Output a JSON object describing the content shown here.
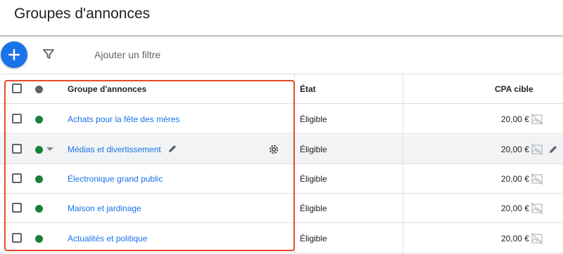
{
  "page": {
    "title": "Groupes d'annonces"
  },
  "toolbar": {
    "add_icon": "plus-icon",
    "filter_icon": "filter-icon",
    "filter_label": "Ajouter un filtre"
  },
  "table": {
    "headers": {
      "name": "Groupe d'annonces",
      "status": "État",
      "cpa": "CPA cible"
    },
    "rows": [
      {
        "name": "Achats pour la fête des mères",
        "status": "Éligible",
        "cpa": "20,00 €"
      },
      {
        "name": "Médias et divertissement",
        "status": "Éligible",
        "cpa": "20,00 €"
      },
      {
        "name": "Électronique grand public",
        "status": "Éligible",
        "cpa": "20,00 €"
      },
      {
        "name": "Maison et jardinage",
        "status": "Éligible",
        "cpa": "20,00 €"
      },
      {
        "name": "Actualités et politique",
        "status": "Éligible",
        "cpa": "20,00 €"
      }
    ]
  },
  "colors": {
    "accent": "#1a73e8",
    "status_enabled": "#188038",
    "highlight": "#e8492b"
  }
}
